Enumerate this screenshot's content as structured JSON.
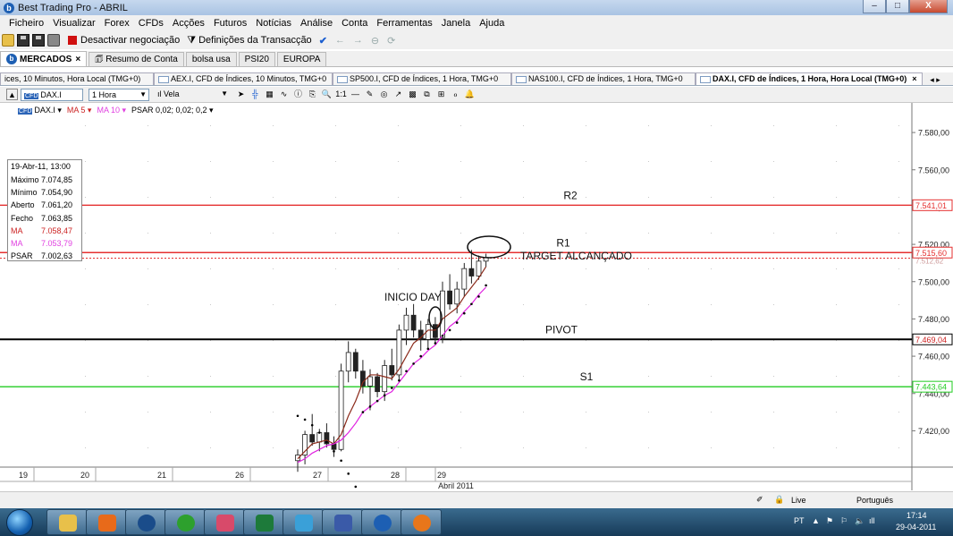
{
  "window": {
    "title": "Best Trading Pro - ABRIL",
    "min": "–",
    "max": "□",
    "close": "X"
  },
  "menu": [
    "Ficheiro",
    "Visualizar",
    "Forex",
    "CFDs",
    "Acções",
    "Futuros",
    "Notícias",
    "Análise",
    "Conta",
    "Ferramentas",
    "Janela",
    "Ajuda"
  ],
  "toolbar": {
    "stop_label": "Desactivar negociação",
    "settings_label": "Definições da Transacção"
  },
  "workspace_tabs": [
    {
      "label": "MERCADOS",
      "active": true,
      "close": "×"
    },
    {
      "label": "Resumo de Conta",
      "active": false
    },
    {
      "label": "bolsa usa",
      "active": false
    },
    {
      "label": "PSI20",
      "active": false
    },
    {
      "label": "EUROPA",
      "active": false
    }
  ],
  "chart_tabs": [
    {
      "label": "ices, 10 Minutos, Hora Local (TMG+0)",
      "active": false
    },
    {
      "label": "AEX.I, CFD de Índices, 10 Minutos, TMG+0",
      "active": false
    },
    {
      "label": "SP500.I, CFD de Índices, 1 Hora, TMG+0",
      "active": false
    },
    {
      "label": "NAS100.I, CFD de Índices, 1 Hora, TMG+0",
      "active": false
    },
    {
      "label": "DAX.I, CFD de Índices, 1 Hora, Hora Local (TMG+0)",
      "active": true,
      "close": "×"
    }
  ],
  "chart_toolbar": {
    "symbol": "DAX.I",
    "timeframe": "1 Hora",
    "chart_style": "Vela",
    "cfd_badge": "CFD"
  },
  "indicators": [
    "DAX.I ▾",
    "MA 5 ▾",
    "MA 10 ▾",
    "PSAR 0,02; 0,02; 0,2 ▾"
  ],
  "info_panel": {
    "header": "19-Abr-11, 13:00",
    "rows": [
      {
        "k": "Máximo",
        "v": "7.074,85",
        "color": "#000000"
      },
      {
        "k": "Mínimo",
        "v": "7.054,90",
        "color": "#000000"
      },
      {
        "k": "Aberto",
        "v": "7.061,20",
        "color": "#000000"
      },
      {
        "k": "Fecho",
        "v": "7.063,85",
        "color": "#000000"
      },
      {
        "k": "MA",
        "v": "7.058,47",
        "color": "#cc2222"
      },
      {
        "k": "MA",
        "v": "7.053,79",
        "color": "#e040e0"
      },
      {
        "k": "PSAR",
        "v": "7.002,63",
        "color": "#000000"
      }
    ]
  },
  "chart_data": {
    "type": "candlestick",
    "y_ticks": [
      "7.580,00",
      "7.560,00",
      "7.540,00",
      "7.520,00",
      "7.500,00",
      "7.480,00",
      "7.460,00",
      "7.440,00",
      "7.420,00"
    ],
    "y_tick_values": [
      7580,
      7560,
      7540,
      7520,
      7500,
      7480,
      7460,
      7440,
      7420
    ],
    "x_labels": [
      "19",
      "20",
      "21",
      "26",
      "27",
      "28",
      "29"
    ],
    "x_month_label": "Abril 2011",
    "ylim": [
      7401,
      7593
    ],
    "levels": [
      {
        "name": "R2",
        "value": 7541.01,
        "label": "7.541,01",
        "color": "#e53030"
      },
      {
        "name": "R1",
        "value": 7515.6,
        "label": "7.515,60",
        "color": "#e53030"
      },
      {
        "name": "PIVOT",
        "value": 7469.04,
        "label": "7.469,04",
        "color": "#000000"
      },
      {
        "name": "S1",
        "value": 7443.64,
        "label": "7.443,64",
        "color": "#22cc22"
      }
    ],
    "hidden_level_label": "7.512,62",
    "annotations": [
      "INICIO DAY",
      "TARGET ALCANÇADO"
    ],
    "candles": [
      {
        "o": 7404,
        "h": 7410,
        "l": 7398,
        "c": 7407
      },
      {
        "o": 7407,
        "h": 7420,
        "l": 7402,
        "c": 7418
      },
      {
        "o": 7418,
        "h": 7429,
        "l": 7412,
        "c": 7414
      },
      {
        "o": 7414,
        "h": 7421,
        "l": 7409,
        "c": 7419
      },
      {
        "o": 7419,
        "h": 7424,
        "l": 7411,
        "c": 7413
      },
      {
        "o": 7413,
        "h": 7417,
        "l": 7406,
        "c": 7410
      },
      {
        "o": 7410,
        "h": 7456,
        "l": 7409,
        "c": 7452
      },
      {
        "o": 7452,
        "h": 7468,
        "l": 7446,
        "c": 7462
      },
      {
        "o": 7462,
        "h": 7464,
        "l": 7448,
        "c": 7452
      },
      {
        "o": 7452,
        "h": 7458,
        "l": 7440,
        "c": 7444
      },
      {
        "o": 7444,
        "h": 7453,
        "l": 7431,
        "c": 7449
      },
      {
        "o": 7449,
        "h": 7451,
        "l": 7438,
        "c": 7441
      },
      {
        "o": 7441,
        "h": 7458,
        "l": 7436,
        "c": 7455
      },
      {
        "o": 7455,
        "h": 7464,
        "l": 7447,
        "c": 7450
      },
      {
        "o": 7450,
        "h": 7477,
        "l": 7446,
        "c": 7474
      },
      {
        "o": 7474,
        "h": 7486,
        "l": 7466,
        "c": 7482
      },
      {
        "o": 7482,
        "h": 7488,
        "l": 7470,
        "c": 7474
      },
      {
        "o": 7474,
        "h": 7479,
        "l": 7463,
        "c": 7469
      },
      {
        "o": 7469,
        "h": 7480,
        "l": 7464,
        "c": 7477
      },
      {
        "o": 7477,
        "h": 7481,
        "l": 7466,
        "c": 7470
      },
      {
        "o": 7470,
        "h": 7500,
        "l": 7467,
        "c": 7495
      },
      {
        "o": 7495,
        "h": 7504,
        "l": 7485,
        "c": 7488
      },
      {
        "o": 7488,
        "h": 7500,
        "l": 7483,
        "c": 7496
      },
      {
        "o": 7496,
        "h": 7510,
        "l": 7492,
        "c": 7507
      },
      {
        "o": 7507,
        "h": 7517,
        "l": 7499,
        "c": 7503
      },
      {
        "o": 7503,
        "h": 7514,
        "l": 7501,
        "c": 7511
      },
      {
        "o": 7511,
        "h": 7515,
        "l": 7508,
        "c": 7513
      }
    ],
    "ma5": [
      7405,
      7409,
      7413,
      7414,
      7415,
      7413,
      7418,
      7428,
      7436,
      7446,
      7450,
      7450,
      7449,
      7448,
      7453,
      7460,
      7467,
      7470,
      7474,
      7474,
      7480,
      7483,
      7486,
      7492,
      7497,
      7502,
      7508
    ],
    "ma10": [
      7403,
      7405,
      7408,
      7410,
      7412,
      7413,
      7415,
      7419,
      7424,
      7430,
      7433,
      7436,
      7439,
      7441,
      7446,
      7451,
      7456,
      7459,
      7463,
      7466,
      7471,
      7476,
      7479,
      7484,
      7488,
      7493,
      7497
    ],
    "psar": [
      7428,
      7426,
      7423,
      7419,
      7414,
      7409,
      7404,
      7397,
      7390,
      7430,
      7433,
      7436,
      7439,
      7443,
      7447,
      7452,
      7456,
      7460,
      7464,
      7467,
      7471,
      7474,
      7478,
      7483,
      7488,
      7492,
      7498
    ]
  },
  "statusbar": {
    "live_label": "Live",
    "language": "Português"
  },
  "tray": {
    "lang": "PT",
    "time": "17:14",
    "date": "29-04-2011"
  }
}
